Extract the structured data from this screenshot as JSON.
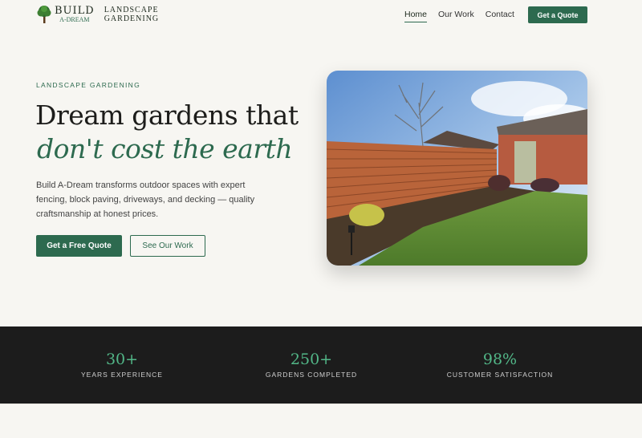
{
  "brand": {
    "logo_word": "BUILD",
    "logo_sub": "A-DREAM",
    "tagline_line1": "LANDSCAPE",
    "tagline_line2": "GARDENING"
  },
  "nav": {
    "links": [
      {
        "label": "Home",
        "active": true
      },
      {
        "label": "Our Work",
        "active": false
      },
      {
        "label": "Contact",
        "active": false
      }
    ],
    "cta_label": "Get a Quote"
  },
  "hero": {
    "eyebrow": "LANDSCAPE GARDENING",
    "heading_line1": "Dream gardens that",
    "heading_line2": "don't cost the earth",
    "lead": "Build A-Dream transforms outdoor spaces with expert fencing, block paving, driveways, and decking — quality craftsmanship at honest prices.",
    "primary_button": "Get a Free Quote",
    "secondary_button": "See Our Work"
  },
  "stats": [
    {
      "value": "30+",
      "label": "YEARS EXPERIENCE"
    },
    {
      "value": "250+",
      "label": "GARDENS COMPLETED"
    },
    {
      "value": "98%",
      "label": "CUSTOMER SATISFACTION"
    }
  ],
  "colors": {
    "accent": "#2d6a4f",
    "stat_accent": "#52b788",
    "dark_band": "#1c1c1c",
    "background": "#f7f6f2"
  }
}
